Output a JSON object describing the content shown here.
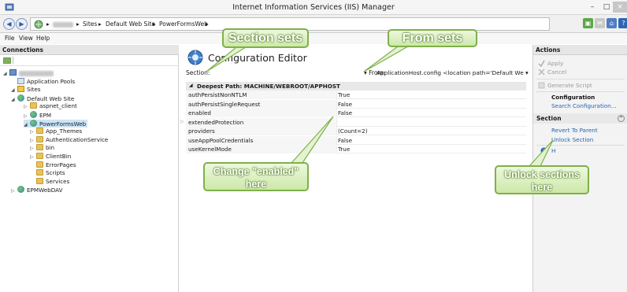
{
  "window": {
    "title": "Internet Information Services (IIS) Manager",
    "min_glyph": "–",
    "max_glyph": "□",
    "close_glyph": "×"
  },
  "address": {
    "sep": "▸",
    "crumbs": [
      "Sites",
      "Default Web Site",
      "PowerFormsWeb"
    ]
  },
  "menu": {
    "items": [
      "File",
      "View",
      "Help"
    ]
  },
  "connections": {
    "header": "Connections",
    "tree": [
      {
        "label": "",
        "icon": "server-icon",
        "level": 0,
        "expanded": true,
        "blurred": true
      },
      {
        "label": "Application Pools",
        "icon": "app-pool-icon",
        "level": 1,
        "expanded": null
      },
      {
        "label": "Sites",
        "icon": "sites-icon",
        "level": 1,
        "expanded": true
      },
      {
        "label": "Default Web Site",
        "icon": "globe-icon",
        "level": 2,
        "expanded": true
      },
      {
        "label": "aspnet_client",
        "icon": "folder-icon",
        "level": 3,
        "expanded": false
      },
      {
        "label": "EPM",
        "icon": "globe-icon",
        "level": 3,
        "expanded": false
      },
      {
        "label": "PowerFormsWeb",
        "icon": "globe-icon",
        "level": 3,
        "expanded": true,
        "selected": true
      },
      {
        "label": "App_Themes",
        "icon": "folder-icon",
        "level": 4,
        "expanded": false
      },
      {
        "label": "AuthenticationService",
        "icon": "folder-icon",
        "level": 4,
        "expanded": false
      },
      {
        "label": "bin",
        "icon": "folder-icon",
        "level": 4,
        "expanded": false
      },
      {
        "label": "ClientBin",
        "icon": "folder-icon",
        "level": 4,
        "expanded": false
      },
      {
        "label": "ErrorPages",
        "icon": "folder-icon",
        "level": 4,
        "expanded": null
      },
      {
        "label": "Scripts",
        "icon": "folder-icon",
        "level": 4,
        "expanded": null
      },
      {
        "label": "Services",
        "icon": "folder-icon",
        "level": 4,
        "expanded": null
      },
      {
        "label": "EPMWebDAV",
        "icon": "globe-icon",
        "level": 2,
        "expanded": false
      }
    ]
  },
  "editor": {
    "title": "Configuration Editor",
    "section_label": "Section:",
    "from_label": "From:",
    "from_value": "ApplicationHost.config <location path='Default We",
    "dropdown_glyph": "▾",
    "path_header": "Deepest Path: MACHINE/WEBROOT/APPHOST",
    "rows": [
      {
        "key": "authPersistNonNTLM",
        "value": "True",
        "expandable": false
      },
      {
        "key": "authPersistSingleRequest",
        "value": "False",
        "expandable": false
      },
      {
        "key": "enabled",
        "value": "False",
        "expandable": false
      },
      {
        "key": "extendedProtection",
        "value": "",
        "expandable": true
      },
      {
        "key": "providers",
        "value": "(Count=2)",
        "expandable": false
      },
      {
        "key": "useAppPoolCredentials",
        "value": "False",
        "expandable": false
      },
      {
        "key": "useKernelMode",
        "value": "True",
        "expandable": false
      }
    ]
  },
  "actions": {
    "header": "Actions",
    "apply": "Apply",
    "cancel": "Cancel",
    "generate_script": "Generate Script",
    "configuration": "Configuration",
    "search_configuration": "Search Configuration...",
    "section_group": "Section",
    "revert_to_parent": "Revert To Parent",
    "unlock_section": "Unlock Section",
    "help": "H"
  },
  "annotations": {
    "section_sets": "Section sets",
    "from_sets": "From sets",
    "change_enabled_line1": "Change \"enabled\"",
    "change_enabled_line2": "here",
    "unlock_line1": "Unlock sections",
    "unlock_line2": "here",
    "color_fill": "#cde8a9",
    "color_border": "#7fb04a"
  }
}
